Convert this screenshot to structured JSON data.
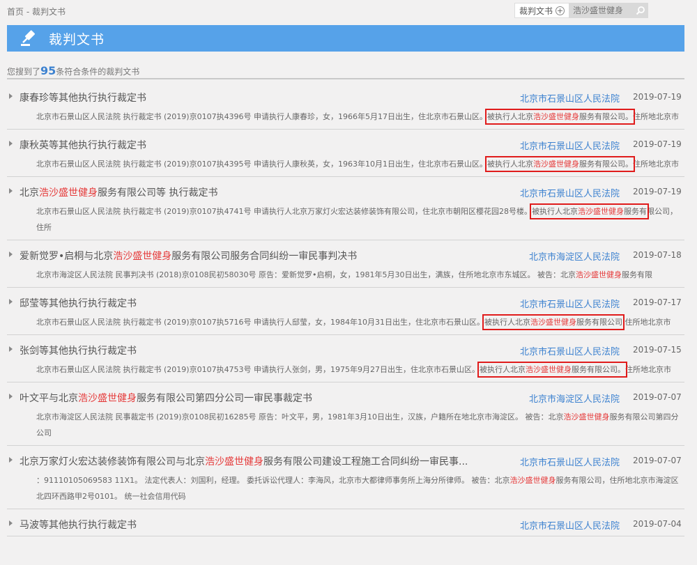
{
  "breadcrumb": {
    "home": "首页",
    "sep": " - ",
    "current": "裁判文书"
  },
  "search": {
    "category": "裁判文书",
    "placeholder": "浩沙盛世健身"
  },
  "header": {
    "title": "裁判文书"
  },
  "results": {
    "prefix": "您搜到了",
    "count": "95",
    "suffix": "条符合条件的裁判文书"
  },
  "items": [
    {
      "title": [
        "康春珍等其他执行执行裁定书"
      ],
      "court": "北京市石景山区人民法院",
      "date": "2019-07-19",
      "summary_before": "北京市石景山区人民法院 执行裁定书 (2019)京0107执4396号 申请执行人康春珍，女，1966年5月17日出生，住北京市石景山区。",
      "summary_box": [
        "被执行人北京",
        "浩沙盛世健身",
        "服务有限公司。"
      ],
      "summary_after": "住所地北京市"
    },
    {
      "title": [
        "康秋英等其他执行执行裁定书"
      ],
      "court": "北京市石景山区人民法院",
      "date": "2019-07-19",
      "summary_before": "北京市石景山区人民法院 执行裁定书 (2019)京0107执4395号 申请执行人康秋英，女，1963年10月1日出生，住北京市石景山区。",
      "summary_box": [
        "被执行人北京",
        "浩沙盛世健身",
        "服务有限公司。"
      ],
      "summary_after": "住所地北京市"
    },
    {
      "title": [
        "北京",
        "浩沙盛世健身",
        "服务有限公司等 执行裁定书"
      ],
      "court": "北京市石景山区人民法院",
      "date": "2019-07-19",
      "summary_before": "北京市石景山区人民法院 执行裁定书 (2019)京0107执4741号 申请执行人北京万家灯火宏达装修装饰有限公司，住北京市朝阳区樱花园28号楼。",
      "summary_box": [
        "被执行人北京",
        "浩沙盛世健身",
        "服务有"
      ],
      "summary_after": "限公司，住所"
    },
    {
      "title": [
        "爱新觉罗•启桐与北京",
        "浩沙盛世健身",
        "服务有限公司服务合同纠纷一审民事判决书"
      ],
      "court": "北京市海淀区人民法院",
      "date": "2019-07-18",
      "summary_before": "北京市海淀区人民法院 民事判决书 (2018)京0108民初58030号 原告：爱新觉罗•启桐，女，1981年5月30日出生，满族，住所地北京市东城区。 被告：北京",
      "summary_hl": [
        "浩沙盛世健身",
        "服务有限"
      ],
      "summary_after": ""
    },
    {
      "title": [
        "邸莹等其他执行执行裁定书"
      ],
      "court": "北京市石景山区人民法院",
      "date": "2019-07-17",
      "summary_before": "北京市石景山区人民法院 执行裁定书 (2019)京0107执5716号 申请执行人邸莹，女，1984年10月31日出生，住北京市石景山区。",
      "summary_box": [
        "被执行人北京",
        "浩沙盛世健身",
        "服务有限公司"
      ],
      "summary_after": " 住所地北京市"
    },
    {
      "title": [
        "张剑等其他执行执行裁定书"
      ],
      "court": "北京市石景山区人民法院",
      "date": "2019-07-15",
      "summary_before": "北京市石景山区人民法院 执行裁定书 (2019)京0107执4753号 申请执行人张剑，男，1975年9月27日出生，住北京市石景山区。",
      "summary_box": [
        "被执行人北京",
        "浩沙盛世健身",
        "服务有限公司。"
      ],
      "summary_after": "住所地北京市"
    },
    {
      "title": [
        "叶文平与北京",
        "浩沙盛世健身",
        "服务有限公司第四分公司一审民事裁定书"
      ],
      "court": "北京市海淀区人民法院",
      "date": "2019-07-07",
      "summary_before": "北京市海淀区人民法院 民事裁定书 (2019)京0108民初16285号 原告：叶文平，男，1981年3月10日出生，汉族，户籍所在地北京市海淀区。 被告：北京",
      "summary_hl": [
        "浩沙盛世健身",
        "服务有限公司第四分公司"
      ],
      "summary_after": ""
    },
    {
      "title": [
        "北京万家灯火宏达装修装饰有限公司与北京",
        "浩沙盛世健身",
        "服务有限公司建设工程施工合同纠纷一审民事..."
      ],
      "court": "北京市石景山区人民法院",
      "date": "2019-07-07",
      "summary_before": "：91110105069583 11X1。 法定代表人：刘国利，经理。 委托诉讼代理人：李海风，北京市大都律师事务所上海分所律师。 被告：北京",
      "summary_hl": [
        "浩沙盛世健身",
        "服务有限公司，住所地北京市海淀区北四环西路甲2号0101。 统一社会信用代码"
      ],
      "summary_after": ""
    },
    {
      "title": [
        "马波等其他执行执行裁定书"
      ],
      "court": "北京市石景山区人民法院",
      "date": "2019-07-04",
      "summary_before": "",
      "summary_after": ""
    }
  ]
}
